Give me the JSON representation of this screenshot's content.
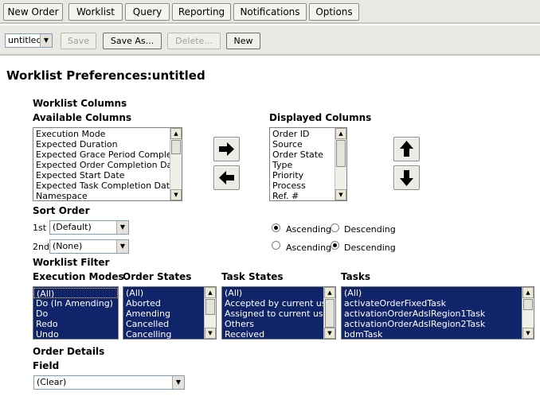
{
  "nav": {
    "tabs": [
      "New Order",
      "Worklist",
      "Query",
      "Reporting",
      "Notifications",
      "Options"
    ]
  },
  "toolbar": {
    "profile_select": "untitled",
    "save_label": "Save",
    "save_as_label": "Save As...",
    "delete_label": "Delete...",
    "new_label": "New"
  },
  "page": {
    "title": "Worklist Preferences:untitled"
  },
  "columns": {
    "section_label": "Worklist Columns",
    "available_label": "Available Columns",
    "available_items": [
      "Execution Mode",
      "Expected Duration",
      "Expected Grace Period Completion",
      "Expected Order Completion Date",
      "Expected Start Date",
      "Expected Task Completion Date",
      "Namespace"
    ],
    "displayed_label": "Displayed Columns",
    "displayed_items": [
      "Order ID",
      "Source",
      "Order State",
      "Type",
      "Priority",
      "Process",
      "Ref. #"
    ]
  },
  "sort": {
    "label": "Sort Order",
    "first_label": "1st",
    "first_value": "(Default)",
    "second_label": "2nd",
    "second_value": "(None)",
    "ascending_label": "Ascending",
    "descending_label": "Descending",
    "first_direction": "ascending",
    "second_direction": "descending"
  },
  "filter": {
    "label": "Worklist Filter",
    "execution_modes": {
      "label": "Execution Modes",
      "items": [
        "(All)",
        "Do (In Amending)",
        "Do",
        "Redo",
        "Undo"
      ]
    },
    "order_states": {
      "label": "Order States",
      "items": [
        "(All)",
        "Aborted",
        "Amending",
        "Cancelled",
        "Cancelling"
      ]
    },
    "task_states": {
      "label": "Task States",
      "items": [
        "(All)",
        "Accepted by current user",
        "Assigned to current user",
        "Others",
        "Received"
      ]
    },
    "tasks": {
      "label": "Tasks",
      "items": [
        "(All)",
        "activateOrderFixedTask",
        "activationOrderAdslRegion1Task",
        "activationOrderAdslRegion2Task",
        "bdmTask"
      ]
    }
  },
  "order_details": {
    "label": "Order Details",
    "field_label": "Field",
    "field_value": "(Clear)"
  }
}
